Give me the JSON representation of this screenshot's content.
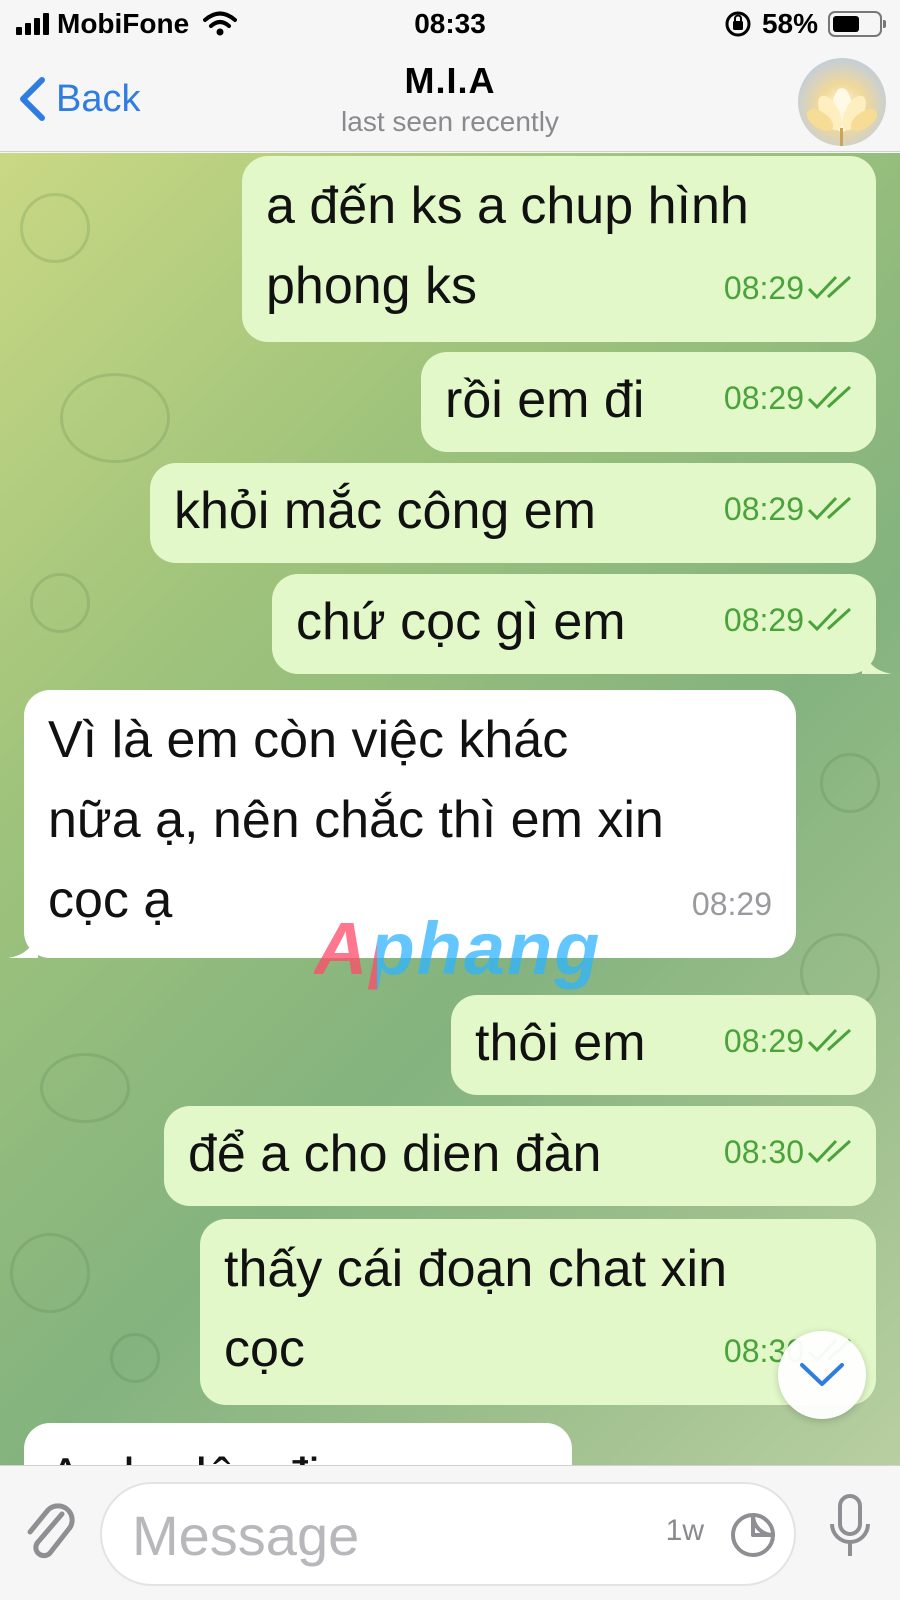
{
  "status_bar": {
    "carrier": "MobiFone",
    "time": "08:33",
    "battery_pct": "58%",
    "battery_level": 0.58
  },
  "header": {
    "back_label": "Back",
    "title": "M.I.A",
    "subtitle": "last seen recently"
  },
  "messages": [
    {
      "dir": "out",
      "lines": [
        "a đến ks a chup hình",
        "phong ks"
      ],
      "time": "08:29",
      "status": "read"
    },
    {
      "dir": "out",
      "lines": [
        "rồi em đi"
      ],
      "time": "08:29",
      "status": "read"
    },
    {
      "dir": "out",
      "lines": [
        "khỏi mắc công em"
      ],
      "time": "08:29",
      "status": "read"
    },
    {
      "dir": "out",
      "lines": [
        "chứ cọc gì em"
      ],
      "time": "08:29",
      "status": "read"
    },
    {
      "dir": "in",
      "lines": [
        "Vì là em còn việc khác",
        "nữa ạ, nên chắc thì em xin",
        "cọc ạ"
      ],
      "time": "08:29"
    },
    {
      "dir": "out",
      "lines": [
        "thôi em"
      ],
      "time": "08:29",
      "status": "read"
    },
    {
      "dir": "out",
      "lines": [
        "để a cho dien đàn"
      ],
      "time": "08:30",
      "status": "read"
    },
    {
      "dir": "out",
      "lines": [
        "thấy cái đoạn chat xin",
        "cọc"
      ],
      "time": "08:30",
      "status": "read"
    },
    {
      "dir": "in",
      "lines": [
        "A nhe lên đi"
      ],
      "time": ""
    }
  ],
  "watermark": "Aphang",
  "composer": {
    "placeholder": "Message",
    "timer_label": "1w"
  },
  "colors": {
    "accent": "#2f7de1",
    "outgoing_bubble": "#e2f8c9",
    "incoming_bubble": "#ffffff",
    "read_check": "#4aa33a"
  }
}
